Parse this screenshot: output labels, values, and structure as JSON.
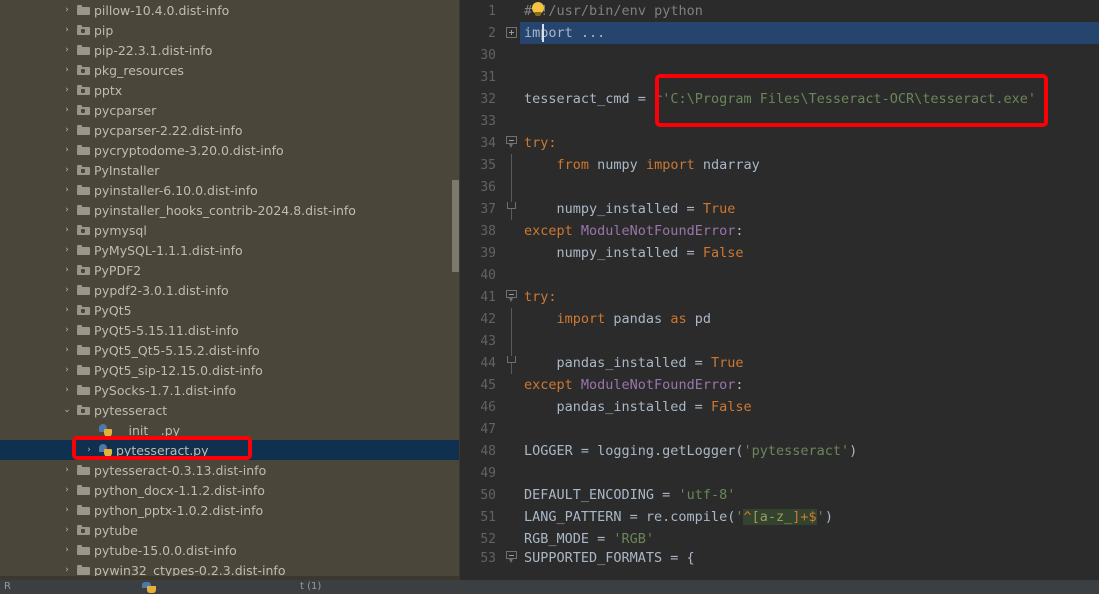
{
  "app": {
    "theme_colors": {
      "sidebar_bg": "#4a4639",
      "editor_bg": "#2b2b2b",
      "selection_blue": "#26456e",
      "tree_selection": "#10304f",
      "annotation_red": "#fb0007",
      "string_green": "#6a8759",
      "keyword_orange": "#cc7832",
      "class_purple": "#9876aa",
      "gutter_gray": "#606366"
    }
  },
  "sidebar": {
    "name": "project-tree",
    "scrollbar": {
      "name": "tree-scrollbar"
    },
    "items": [
      {
        "label": "pillow-10.4.0.dist-info",
        "icon": "folder-icon",
        "twisty": "›",
        "indent": 0,
        "selected": false
      },
      {
        "label": "pip",
        "icon": "package-folder-icon",
        "twisty": "›",
        "indent": 0,
        "selected": false
      },
      {
        "label": "pip-22.3.1.dist-info",
        "icon": "folder-icon",
        "twisty": "›",
        "indent": 0,
        "selected": false
      },
      {
        "label": "pkg_resources",
        "icon": "package-folder-icon",
        "twisty": "›",
        "indent": 0,
        "selected": false
      },
      {
        "label": "pptx",
        "icon": "package-folder-icon",
        "twisty": "›",
        "indent": 0,
        "selected": false
      },
      {
        "label": "pycparser",
        "icon": "package-folder-icon",
        "twisty": "›",
        "indent": 0,
        "selected": false
      },
      {
        "label": "pycparser-2.22.dist-info",
        "icon": "folder-icon",
        "twisty": "›",
        "indent": 0,
        "selected": false
      },
      {
        "label": "pycryptodome-3.20.0.dist-info",
        "icon": "folder-icon",
        "twisty": "›",
        "indent": 0,
        "selected": false
      },
      {
        "label": "PyInstaller",
        "icon": "package-folder-icon",
        "twisty": "›",
        "indent": 0,
        "selected": false
      },
      {
        "label": "pyinstaller-6.10.0.dist-info",
        "icon": "folder-icon",
        "twisty": "›",
        "indent": 0,
        "selected": false
      },
      {
        "label": "pyinstaller_hooks_contrib-2024.8.dist-info",
        "icon": "folder-icon",
        "twisty": "›",
        "indent": 0,
        "selected": false
      },
      {
        "label": "pymysql",
        "icon": "package-folder-icon",
        "twisty": "›",
        "indent": 0,
        "selected": false
      },
      {
        "label": "PyMySQL-1.1.1.dist-info",
        "icon": "folder-icon",
        "twisty": "›",
        "indent": 0,
        "selected": false
      },
      {
        "label": "PyPDF2",
        "icon": "package-folder-icon",
        "twisty": "›",
        "indent": 0,
        "selected": false
      },
      {
        "label": "pypdf2-3.0.1.dist-info",
        "icon": "folder-icon",
        "twisty": "›",
        "indent": 0,
        "selected": false
      },
      {
        "label": "PyQt5",
        "icon": "package-folder-icon",
        "twisty": "›",
        "indent": 0,
        "selected": false
      },
      {
        "label": "PyQt5-5.15.11.dist-info",
        "icon": "folder-icon",
        "twisty": "›",
        "indent": 0,
        "selected": false
      },
      {
        "label": "PyQt5_Qt5-5.15.2.dist-info",
        "icon": "folder-icon",
        "twisty": "›",
        "indent": 0,
        "selected": false
      },
      {
        "label": "PyQt5_sip-12.15.0.dist-info",
        "icon": "folder-icon",
        "twisty": "›",
        "indent": 0,
        "selected": false
      },
      {
        "label": "PySocks-1.7.1.dist-info",
        "icon": "folder-icon",
        "twisty": "›",
        "indent": 0,
        "selected": false
      },
      {
        "label": "pytesseract",
        "icon": "package-folder-icon",
        "twisty": "⌄",
        "indent": 0,
        "selected": false
      },
      {
        "label": "__init__.py",
        "icon": "python-file-icon",
        "twisty": "",
        "indent": 1,
        "selected": false
      },
      {
        "label": "pytesseract.py",
        "icon": "python-file-icon",
        "twisty": "›",
        "indent": 1,
        "selected": true
      },
      {
        "label": "pytesseract-0.3.13.dist-info",
        "icon": "folder-icon",
        "twisty": "›",
        "indent": 0,
        "selected": false
      },
      {
        "label": "python_docx-1.1.2.dist-info",
        "icon": "folder-icon",
        "twisty": "›",
        "indent": 0,
        "selected": false
      },
      {
        "label": "python_pptx-1.0.2.dist-info",
        "icon": "folder-icon",
        "twisty": "›",
        "indent": 0,
        "selected": false
      },
      {
        "label": "pytube",
        "icon": "package-folder-icon",
        "twisty": "›",
        "indent": 0,
        "selected": false
      },
      {
        "label": "pytube-15.0.0.dist-info",
        "icon": "folder-icon",
        "twisty": "›",
        "indent": 0,
        "selected": false
      },
      {
        "label": "pywin32_ctypes-0.2.3.dist-info",
        "icon": "folder-icon",
        "twisty": "›",
        "indent": 0,
        "selected": false
      }
    ]
  },
  "editor": {
    "name": "code-editor",
    "file": "pytesseract.py",
    "lines": [
      {
        "no": "1",
        "fold": "none",
        "text": "#!/usr/bin/env python",
        "kind": "shebang"
      },
      {
        "no": "2",
        "fold": "plus",
        "text": "import ...",
        "kind": "collapsed-import",
        "selected": true
      },
      {
        "no": "30",
        "fold": "none",
        "text": "",
        "kind": "blank"
      },
      {
        "no": "31",
        "fold": "none",
        "text": "",
        "kind": "blank"
      },
      {
        "no": "32",
        "fold": "none",
        "text": "tesseract_cmd = r'C:\\Program Files\\Tesseract-OCR\\tesseract.exe'",
        "kind": "assign-path"
      },
      {
        "no": "33",
        "fold": "none",
        "text": "",
        "kind": "blank"
      },
      {
        "no": "34",
        "fold": "arrow",
        "text": "try:",
        "kind": "try"
      },
      {
        "no": "35",
        "fold": "line",
        "text": "    from numpy import ndarray",
        "kind": "import-from"
      },
      {
        "no": "36",
        "fold": "line",
        "text": "",
        "kind": "blank"
      },
      {
        "no": "37",
        "fold": "end",
        "text": "    numpy_installed = True",
        "kind": "assign-bool"
      },
      {
        "no": "38",
        "fold": "none",
        "text": "except ModuleNotFoundError:",
        "kind": "except"
      },
      {
        "no": "39",
        "fold": "none",
        "text": "    numpy_installed = False",
        "kind": "assign-bool"
      },
      {
        "no": "40",
        "fold": "none",
        "text": "",
        "kind": "blank"
      },
      {
        "no": "41",
        "fold": "arrow",
        "text": "try:",
        "kind": "try"
      },
      {
        "no": "42",
        "fold": "line",
        "text": "    import pandas as pd",
        "kind": "import-as"
      },
      {
        "no": "43",
        "fold": "line",
        "text": "",
        "kind": "blank"
      },
      {
        "no": "44",
        "fold": "end",
        "text": "    pandas_installed = True",
        "kind": "assign-bool"
      },
      {
        "no": "45",
        "fold": "none",
        "text": "except ModuleNotFoundError:",
        "kind": "except"
      },
      {
        "no": "46",
        "fold": "none",
        "text": "    pandas_installed = False",
        "kind": "assign-bool"
      },
      {
        "no": "47",
        "fold": "none",
        "text": "",
        "kind": "blank"
      },
      {
        "no": "48",
        "fold": "none",
        "text": "LOGGER = logging.getLogger('pytesseract')",
        "kind": "logger"
      },
      {
        "no": "49",
        "fold": "none",
        "text": "",
        "kind": "blank"
      },
      {
        "no": "50",
        "fold": "none",
        "text": "DEFAULT_ENCODING = 'utf-8'",
        "kind": "assign-str"
      },
      {
        "no": "51",
        "fold": "none",
        "text": "LANG_PATTERN = re.compile('^[a-z_]+$')",
        "kind": "assign-regex"
      },
      {
        "no": "52",
        "fold": "none",
        "text": "RGB_MODE = 'RGB'",
        "kind": "assign-str"
      },
      {
        "no": "53",
        "fold": "arrow",
        "text": "SUPPORTED_FORMATS = {",
        "kind": "assign-set",
        "clipped": true
      }
    ],
    "code_tokens": {
      "shebang_hash": "#",
      "shebang_rest": "!/usr/bin/env python",
      "import_collapsed": "import ...",
      "l32_name": "tesseract_cmd",
      "l32_eq": " = ",
      "l32_value": "r'C:\\Program Files\\Tesseract-OCR\\tesseract.exe'",
      "kw_try": "try:",
      "kw_from": "from",
      "mod_numpy": " numpy ",
      "kw_import": "import",
      "sym_ndarray": " ndarray",
      "var_numpy_installed": "    numpy_installed = ",
      "val_true": "True",
      "val_false": "False",
      "kw_except": "except ",
      "exc_name": "ModuleNotFoundError",
      "colon": ":",
      "kw_import2": "    import",
      "mod_pandas": " pandas ",
      "kw_as": "as",
      "alias_pd": " pd",
      "var_pandas_installed": "    pandas_installed = ",
      "l48_lhs": "LOGGER = logging.getLogger(",
      "l48_str": "'pytesseract'",
      "l48_close": ")",
      "l50_lhs": "DEFAULT_ENCODING = ",
      "l50_str": "'utf-8'",
      "l51_lhs": "LANG_PATTERN = re.compile(",
      "l51_q1": "'",
      "l51_caret": "^",
      "l51_class": "[a-z_",
      "l51_bracket": "]",
      "l51_plus": "+",
      "l51_dollar": "$",
      "l51_q2": "'",
      "l51_close": ")",
      "l52_lhs": "RGB_MODE = ",
      "l52_str": "'RGB'",
      "l53_text": "SUPPORTED_FORMATS = {"
    }
  },
  "annotations": [
    {
      "name": "annotation-box-tesseract-path",
      "target": "line 32 string value",
      "color": "#fb0007"
    },
    {
      "name": "annotation-box-selected-file",
      "target": "pytesseract.py tree item",
      "color": "#fb0007"
    }
  ],
  "bottom_bar": {
    "run_label": "R",
    "tab_label": "t (1)"
  }
}
